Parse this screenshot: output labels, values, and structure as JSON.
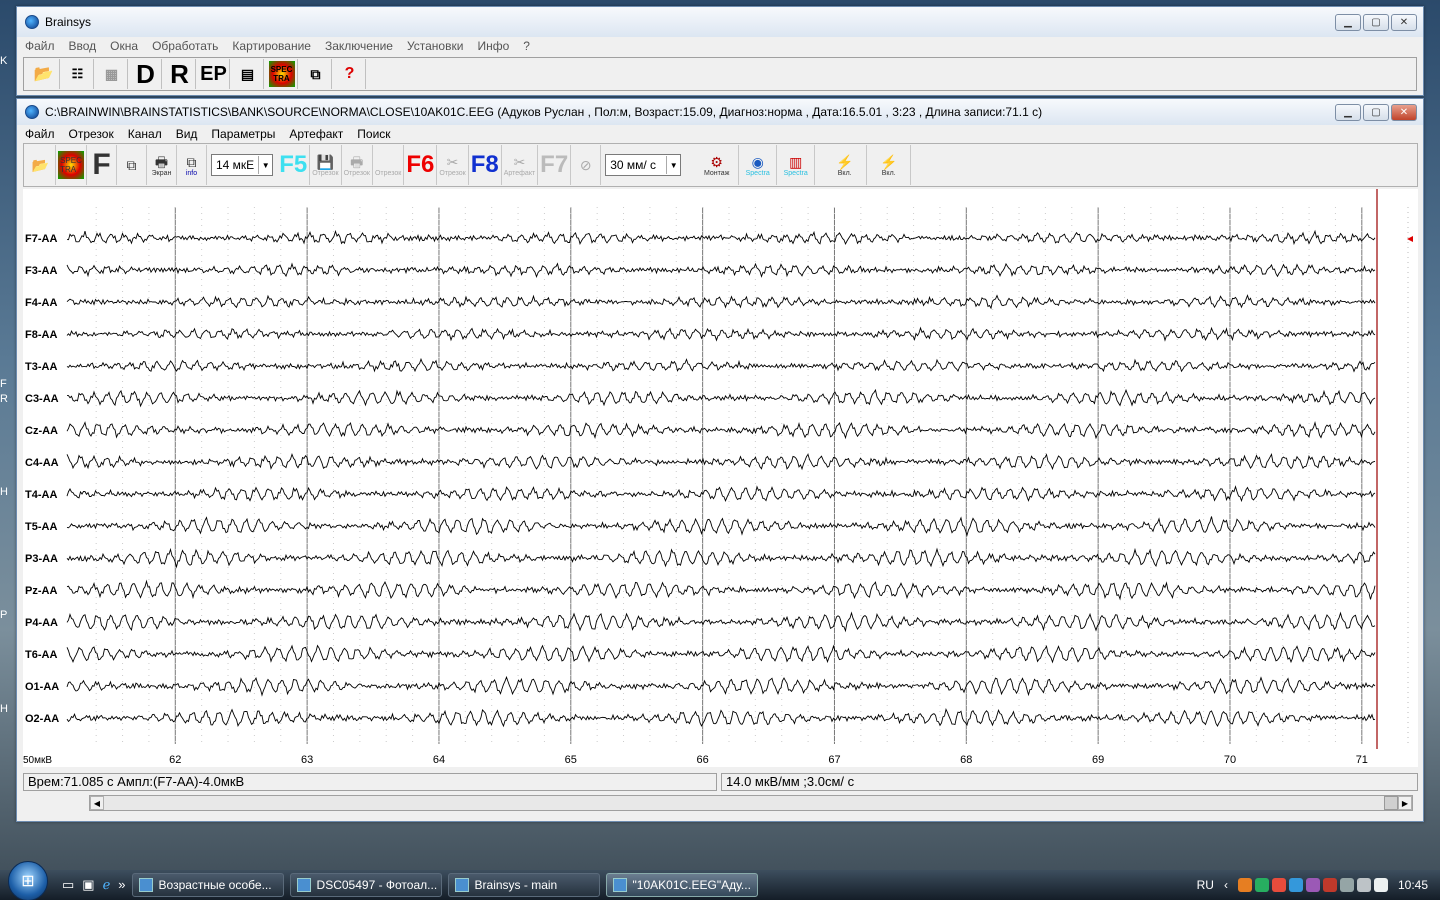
{
  "main_window": {
    "title": "Brainsys",
    "menu": [
      "Файл",
      "Ввод",
      "Окна",
      "Обработать",
      "Картирование",
      "Заключение",
      "Установки",
      "Инфо",
      "?"
    ],
    "toolbar": [
      {
        "name": "open-folder-icon",
        "label": ""
      },
      {
        "name": "tree-icon",
        "label": ""
      },
      {
        "name": "table-icon",
        "label": ""
      },
      {
        "name": "d-button",
        "label": "D"
      },
      {
        "name": "r-button",
        "label": "R"
      },
      {
        "name": "ep-button",
        "label": "EP"
      },
      {
        "name": "calculator-icon",
        "label": ""
      },
      {
        "name": "spectra-icon",
        "label": "SPEC TRA"
      },
      {
        "name": "copy-icon",
        "label": ""
      },
      {
        "name": "help-icon",
        "label": "?"
      }
    ]
  },
  "eeg_window": {
    "title": "C:\\BRAINWIN\\BRAINSTATISTICS\\BANK\\SOURCE\\NORMA\\CLOSE\\10AK01C.EEG (Адуков Руслан , Пол:м, Возраст:15.09, Диагноз:норма , Дата:16.5.01 , 3:23 , Длина записи:71.1 с)",
    "menu": [
      "Файл",
      "Отрезок",
      "Канал",
      "Вид",
      "Параметры",
      "Артефакт",
      "Поиск"
    ],
    "amplitude_select": "14 мкЕ",
    "speed_select": "30 мм/ с",
    "toolbar_labels": {
      "screen": "Экран",
      "info": "info",
      "f5": "F5",
      "f6": "F6",
      "f8": "F8",
      "f7": "F7",
      "segment": "Отрезок",
      "artefact": "Артефакт",
      "montage": "Монтаж",
      "spectra": "Spectra",
      "on": "Вкл."
    }
  },
  "chart_data": {
    "type": "line",
    "channels": [
      "F7-AA",
      "F3-AA",
      "F4-AA",
      "F8-AA",
      "T3-AA",
      "C3-AA",
      "Cz-AA",
      "C4-AA",
      "T4-AA",
      "T5-AA",
      "P3-AA",
      "Pz-AA",
      "P4-AA",
      "T6-AA",
      "O1-AA",
      "O2-AA"
    ],
    "x_ticks": [
      "62",
      "63",
      "64",
      "65",
      "66",
      "67",
      "68",
      "69",
      "70",
      "71"
    ],
    "scale_label": "50мкВ",
    "xlim": [
      61.3,
      71.1
    ]
  },
  "status": {
    "left": "Врем:71.085 с Ампл:(F7-AA)-4.0мкВ",
    "right": "14.0 мкВ/мм ;3.0см/ с"
  },
  "taskbar": {
    "tasks": [
      "Возрастные особе...",
      "DSC05497 - Фотоал...",
      "Brainsys - main",
      "\"10AK01C.EEG\"Аду..."
    ],
    "lang": "RU",
    "time": "10:45"
  },
  "desktop_letters": [
    "K",
    "F",
    "R",
    "H",
    "P",
    "H"
  ]
}
